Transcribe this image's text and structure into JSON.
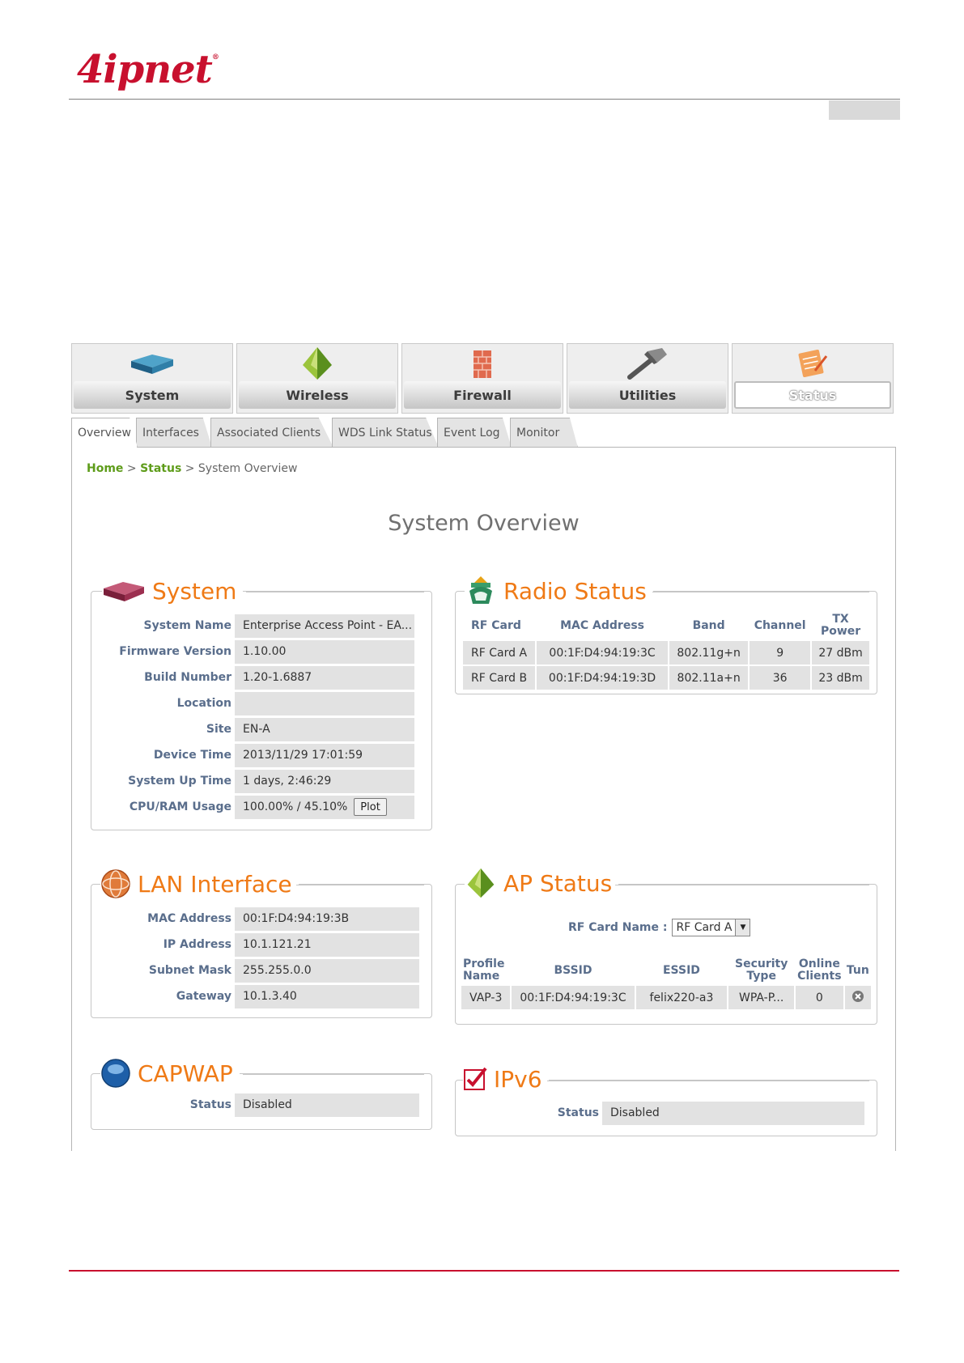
{
  "brand": {
    "logo": "4ipnet",
    "reg": "®"
  },
  "nav": [
    {
      "label": "System",
      "icon": "router-icon"
    },
    {
      "label": "Wireless",
      "icon": "wireless-pyramid-icon"
    },
    {
      "label": "Firewall",
      "icon": "firewall-brick-icon"
    },
    {
      "label": "Utilities",
      "icon": "hammer-icon"
    },
    {
      "label": "Status",
      "icon": "status-notepad-icon",
      "active": true
    }
  ],
  "subtabs": [
    "Overview",
    "Interfaces",
    "Associated Clients",
    "WDS Link Status",
    "Event Log",
    "Monitor"
  ],
  "breadcrumb": {
    "home": "Home",
    "sep1": ">",
    "status": "Status",
    "sep2": ">",
    "current": "System Overview"
  },
  "page_title": "System Overview",
  "system": {
    "title": "System",
    "fields": [
      {
        "label": "System Name",
        "value": "Enterprise Access Point - EA..."
      },
      {
        "label": "Firmware Version",
        "value": "1.10.00"
      },
      {
        "label": "Build Number",
        "value": "1.20-1.6887"
      },
      {
        "label": "Location",
        "value": ""
      },
      {
        "label": "Site",
        "value": "EN-A"
      },
      {
        "label": "Device Time",
        "value": "2013/11/29 17:01:59"
      },
      {
        "label": "System Up Time",
        "value": "1 days, 2:46:29"
      },
      {
        "label": "CPU/RAM Usage",
        "value": "100.00% / 45.10%"
      }
    ],
    "plot_button": "Plot"
  },
  "radio": {
    "title": "Radio Status",
    "headers": [
      "RF Card",
      "MAC Address",
      "Band",
      "Channel",
      "TX Power"
    ],
    "rows": [
      [
        "RF Card A",
        "00:1F:D4:94:19:3C",
        "802.11g+n",
        "9",
        "27 dBm"
      ],
      [
        "RF Card B",
        "00:1F:D4:94:19:3D",
        "802.11a+n",
        "36",
        "23 dBm"
      ]
    ]
  },
  "lan": {
    "title": "LAN Interface",
    "fields": [
      {
        "label": "MAC Address",
        "value": "00:1F:D4:94:19:3B"
      },
      {
        "label": "IP Address",
        "value": "10.1.121.21"
      },
      {
        "label": "Subnet Mask",
        "value": "255.255.0.0"
      },
      {
        "label": "Gateway",
        "value": "10.1.3.40"
      }
    ]
  },
  "ap": {
    "title": "AP Status",
    "rf_label": "RF Card Name :",
    "rf_selected": "RF Card A",
    "headers": [
      "Profile Name",
      "BSSID",
      "ESSID",
      "Security Type",
      "Online Clients",
      "Tun"
    ],
    "rows": [
      [
        "VAP-3",
        "00:1F:D4:94:19:3C",
        "felix220-a3",
        "WPA-P...",
        "0"
      ]
    ]
  },
  "capwap": {
    "title": "CAPWAP",
    "label": "Status",
    "value": "Disabled"
  },
  "ipv6": {
    "title": "IPv6",
    "label": "Status",
    "value": "Disabled"
  },
  "colors": {
    "accent": "#ef7a16",
    "brand": "#c8102e",
    "link": "#5e9c1a",
    "label": "#5a6e8c"
  }
}
